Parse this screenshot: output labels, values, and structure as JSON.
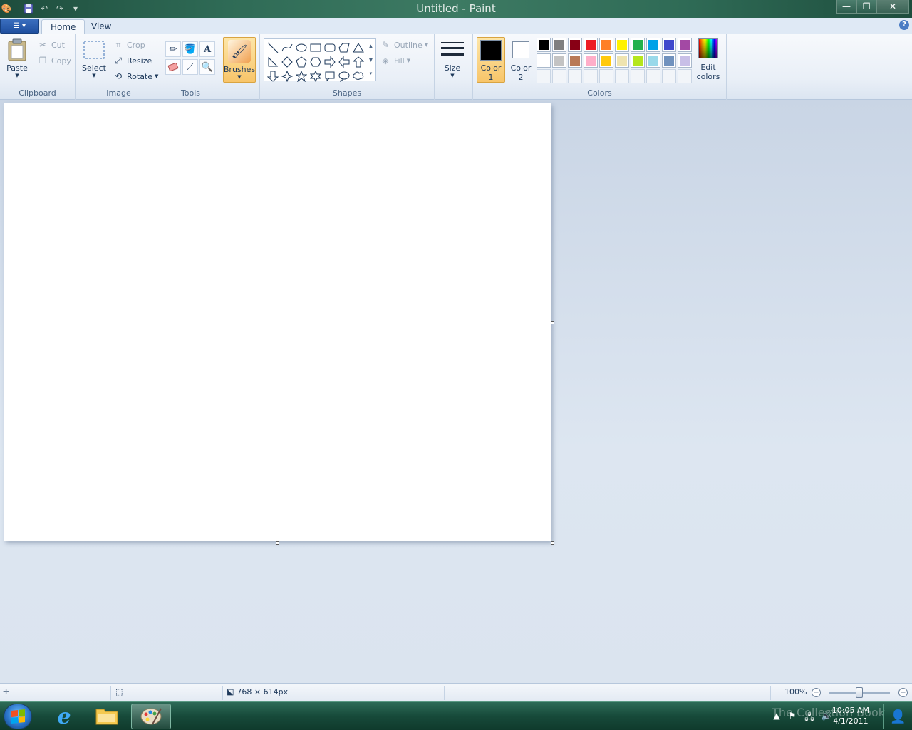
{
  "window": {
    "title": "Untitled - Paint",
    "minimize": "—",
    "restore": "❐",
    "close": "✕"
  },
  "tabs": {
    "home": "Home",
    "view": "View",
    "help": "?"
  },
  "clipboard": {
    "group_label": "Clipboard",
    "paste": "Paste",
    "cut": "Cut",
    "copy": "Copy"
  },
  "image": {
    "group_label": "Image",
    "select": "Select",
    "crop": "Crop",
    "resize": "Resize",
    "rotate": "Rotate"
  },
  "tools": {
    "group_label": "Tools"
  },
  "brushes": {
    "label": "Brushes"
  },
  "shapes": {
    "group_label": "Shapes",
    "outline": "Outline",
    "fill": "Fill"
  },
  "size": {
    "label": "Size"
  },
  "colors": {
    "group_label": "Colors",
    "color1_line1": "Color",
    "color1_line2": "1",
    "color2_line1": "Color",
    "color2_line2": "2",
    "color1_value": "#000000",
    "color2_value": "#ffffff",
    "edit_line1": "Edit",
    "edit_line2": "colors",
    "palette": [
      "#000000",
      "#7f7f7f",
      "#880015",
      "#ed1c24",
      "#ff7f27",
      "#fff200",
      "#22b14c",
      "#00a2e8",
      "#3f48cc",
      "#a349a4",
      "#ffffff",
      "#c3c3c3",
      "#b97a57",
      "#ffaec9",
      "#ffc90e",
      "#efe4b0",
      "#b5e61d",
      "#99d9ea",
      "#7092be",
      "#c8bfe7"
    ]
  },
  "statusbar": {
    "dimensions": "768 × 614px",
    "zoom": "100%",
    "zoom_fraction": 0.5
  },
  "taskbar": {
    "time": "10:05 AM",
    "date": "4/1/2011",
    "watermark": "The Collection Book"
  }
}
